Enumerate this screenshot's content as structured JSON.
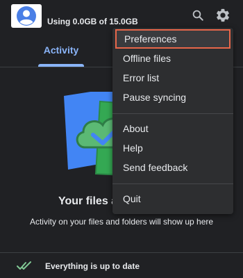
{
  "header": {
    "storage_usage": "Using 0.0GB of 15.0GB",
    "avatar_icon": "account-circle-icon",
    "search_icon": "search-icon",
    "settings_icon": "gear-icon"
  },
  "tabs": [
    {
      "label": "Activity",
      "active": true
    }
  ],
  "empty_state": {
    "title": "Your files a",
    "subtitle": "Activity on your files and folders will show up here",
    "illustration_icon": "cloud-sync-check-icon"
  },
  "footer": {
    "status_icon": "double-check-icon",
    "status_text": "Everything is up to date"
  },
  "menu": {
    "items": [
      {
        "label": "Preferences",
        "highlighted": true
      },
      {
        "label": "Offline files"
      },
      {
        "label": "Error list"
      },
      {
        "label": "Pause syncing"
      },
      {
        "label": "About"
      },
      {
        "label": "Help"
      },
      {
        "label": "Send feedback"
      },
      {
        "label": "Quit"
      }
    ]
  },
  "colors": {
    "background": "#202124",
    "accent": "#8ab4f8",
    "menu_background": "#2d2e30",
    "highlight_border": "#e8674a",
    "check_green": "#34a853",
    "folder_blue": "#4285f4"
  }
}
